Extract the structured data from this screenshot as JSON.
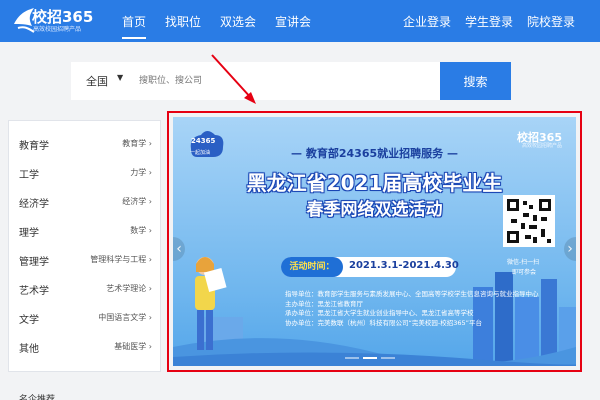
{
  "header": {
    "logo_text": "校招365",
    "logo_sub": "高效校园招聘产品",
    "nav": [
      "首页",
      "找职位",
      "双选会",
      "宣讲会"
    ],
    "active_nav": "首页",
    "login": [
      "企业登录",
      "学生登录",
      "院校登录"
    ]
  },
  "search": {
    "city": "全国",
    "placeholder": "搜职位、搜公司",
    "button": "搜索"
  },
  "sidebar": {
    "items": [
      {
        "left": "教育学",
        "right": "教育学"
      },
      {
        "left": "工学",
        "right": "力学"
      },
      {
        "left": "经济学",
        "right": "经济学"
      },
      {
        "left": "理学",
        "right": "数学"
      },
      {
        "left": "管理学",
        "right": "管理科学与工程"
      },
      {
        "left": "艺术学",
        "right": "艺术学理论"
      },
      {
        "left": "文学",
        "right": "中国语言文学"
      },
      {
        "left": "其他",
        "right": "基础医学"
      }
    ]
  },
  "banner": {
    "badge_line1": "24365",
    "badge_line2": "一起加油",
    "brand": "校招365",
    "brand_sub": "高效校园招聘产品",
    "subtitle": "— 教育部24365就业招聘服务 —",
    "title_line1": "黑龙江省2021届高校毕业生",
    "title_line2": "春季网络双选活动",
    "time_label": "活动时间：",
    "time_value": "2021.3.1-2021.4.30",
    "info": [
      "指导单位：教育部学生服务与素质发展中心、全国高等学校学生信息咨询与就业指导中心",
      "主办单位：黑龙江省教育厅",
      "承办单位：黑龙江省大学生就业创业指导中心、黑龙江省高等学校",
      "协办单位：完美数联（杭州）科技有限公司“完美校园-校招365”平台"
    ],
    "qr_caption1": "微信-扫一扫",
    "qr_caption2": "即可参会"
  },
  "section_peek": "名企推荐",
  "colors": {
    "header_blue": "#2a7ce5",
    "highlight_red": "#e60012"
  }
}
